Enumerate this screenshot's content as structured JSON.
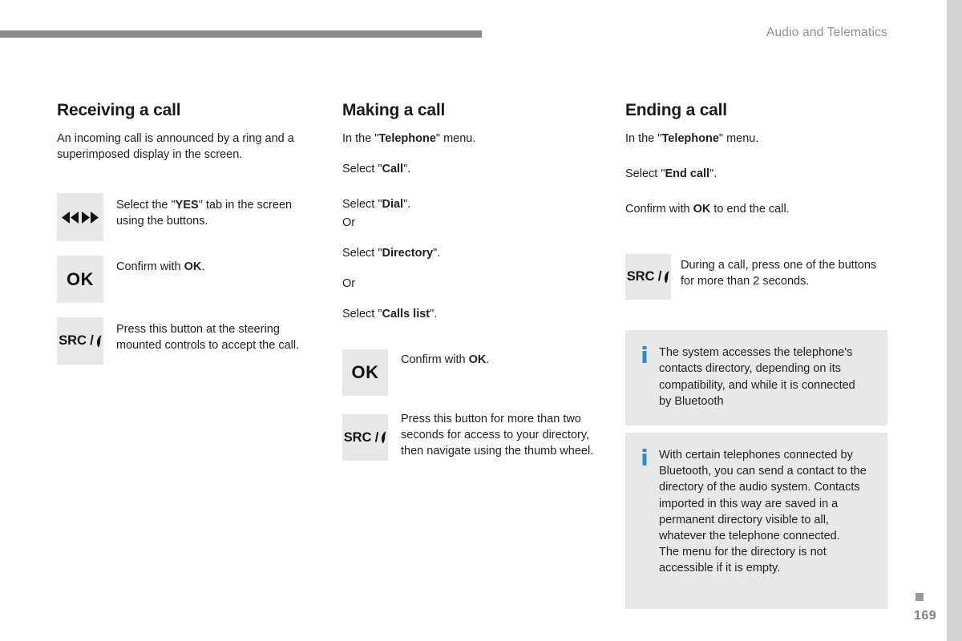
{
  "header": {
    "section_label": "Audio and Telematics",
    "rule_color": "#8a8a8a"
  },
  "footer": {
    "page_number": "169",
    "marker_color": "#9a9a9a"
  },
  "theme": {
    "icon_box_bg": "#e7e8e9",
    "note_bg": "#e7e8e9",
    "info_icon_color": "#2e8fc4",
    "text_color": "#231f20",
    "header_text_color": "#8f9194",
    "edge_strip_color": "#d2d3d5"
  },
  "columns": [
    {
      "id": "receiving-a-call",
      "title": "Receiving a call",
      "intro": "An incoming call is announced by a ring and a superimposed display in the screen.",
      "instructions": [
        {
          "icon": "rewind-forward-icon",
          "icon_label": "◀◀ ▶▶",
          "text_parts": [
            {
              "t": "Select the \"",
              "b": false
            },
            {
              "t": "YES",
              "b": true
            },
            {
              "t": "\" tab in the screen using the buttons.",
              "b": false
            }
          ]
        },
        {
          "icon": "ok-button-icon",
          "icon_label": "OK",
          "text_parts": [
            {
              "t": "Confirm with ",
              "b": false
            },
            {
              "t": "OK",
              "b": true
            },
            {
              "t": ".",
              "b": false
            }
          ]
        },
        {
          "icon": "src-phone-button-icon",
          "icon_label": "SRC /",
          "text_parts": [
            {
              "t": "Press this button at the steering mounted controls to accept the call.",
              "b": false
            }
          ]
        }
      ]
    },
    {
      "id": "making-a-call",
      "title": "Making a call",
      "steps": [
        {
          "parts": [
            {
              "t": "In the \"",
              "b": false
            },
            {
              "t": "Telephone",
              "b": true
            },
            {
              "t": "\" menu.",
              "b": false
            }
          ]
        },
        {
          "parts": [
            {
              "t": "Select \"",
              "b": false
            },
            {
              "t": "Call",
              "b": true
            },
            {
              "t": "\".",
              "b": false
            }
          ]
        },
        {
          "parts": [
            {
              "t": "Select \"",
              "b": false
            },
            {
              "t": "Dial",
              "b": true
            },
            {
              "t": "\".",
              "b": false
            }
          ]
        },
        {
          "parts": [
            {
              "t": "Or",
              "b": false
            }
          ]
        },
        {
          "parts": [
            {
              "t": "Select \"",
              "b": false
            },
            {
              "t": "Directory",
              "b": true
            },
            {
              "t": "\".",
              "b": false
            }
          ]
        },
        {
          "parts": [
            {
              "t": "Or",
              "b": false
            }
          ]
        },
        {
          "parts": [
            {
              "t": "Select \"",
              "b": false
            },
            {
              "t": "Calls list",
              "b": true
            },
            {
              "t": "\".",
              "b": false
            }
          ]
        }
      ],
      "instructions": [
        {
          "icon": "ok-button-icon",
          "icon_label": "OK",
          "text_parts": [
            {
              "t": "Confirm with ",
              "b": false
            },
            {
              "t": "OK",
              "b": true
            },
            {
              "t": ".",
              "b": false
            }
          ]
        },
        {
          "icon": "src-phone-button-icon",
          "icon_label": "SRC /",
          "text_parts": [
            {
              "t": "Press this button for more than two seconds for access to your directory, then navigate using the thumb wheel.",
              "b": false
            }
          ]
        }
      ]
    },
    {
      "id": "ending-a-call",
      "title": "Ending a call",
      "steps": [
        {
          "parts": [
            {
              "t": "In the \"",
              "b": false
            },
            {
              "t": "Telephone",
              "b": true
            },
            {
              "t": "\" menu.",
              "b": false
            }
          ]
        },
        {
          "parts": [
            {
              "t": "Select \"",
              "b": false
            },
            {
              "t": "End call",
              "b": true
            },
            {
              "t": "\".",
              "b": false
            }
          ]
        },
        {
          "parts": [
            {
              "t": "Confirm with ",
              "b": false
            },
            {
              "t": "OK",
              "b": true
            },
            {
              "t": " to end the call.",
              "b": false
            }
          ]
        }
      ],
      "instructions": [
        {
          "icon": "src-phone-button-icon",
          "icon_label": "SRC /",
          "text_parts": [
            {
              "t": "During a call, press one of the buttons for more than 2 seconds.",
              "b": false
            }
          ]
        }
      ],
      "notes": [
        {
          "icon": "info-icon",
          "text": "The system accesses the telephone's contacts directory, depending on its compatibility, and while it is connected by Bluetooth"
        },
        {
          "icon": "info-icon",
          "text": "With certain telephones connected by Bluetooth, you can send a contact to the directory of the audio system. Contacts imported in this way are saved in a permanent directory visible to all, whatever the telephone connected.\nThe menu for the directory is not accessible if it is empty."
        }
      ]
    }
  ]
}
